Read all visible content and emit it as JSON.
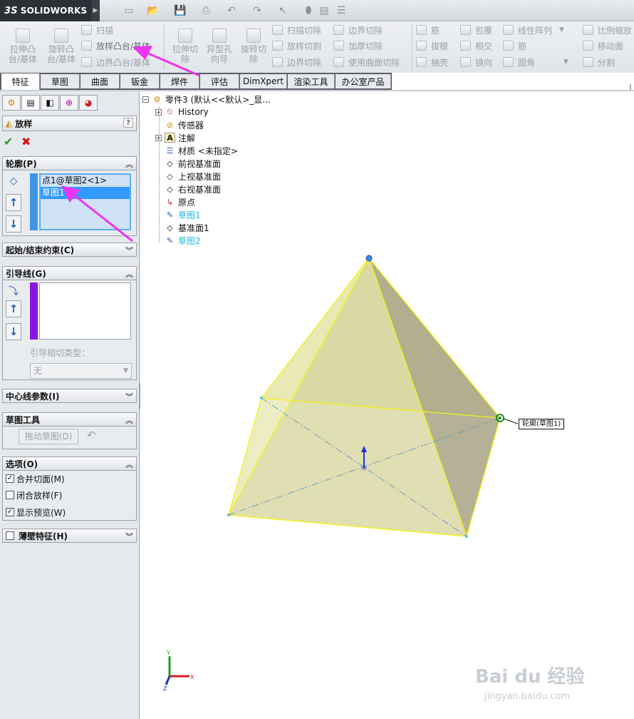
{
  "app": {
    "logo_brand": "SOLIDWORKS",
    "logo_prefix": "3S"
  },
  "ribbon": {
    "extrude_boss": "拉伸凸\n台/基体",
    "revolve_boss": "旋转凸\n台/基体",
    "sweep": "扫描",
    "loft_boss": "放样凸台/基体",
    "boundary_boss": "边界凸台/基体",
    "extrude_cut": "拉伸切\n除",
    "hole_wizard": "异型孔\n向导",
    "revolve_cut": "旋转切\n除",
    "swept_cut": "扫描切除",
    "lofted_cut": "放样切割",
    "boundary_cut": "边界切除",
    "boundary_cut2": "边界切除",
    "thicken_cut": "加厚切除",
    "surface_cut": "使用曲面切除",
    "rib": "筋",
    "draft": "拔模",
    "shell": "抽壳",
    "wrap": "包覆",
    "intersect": "相交",
    "mirror": "镜向",
    "linear_pattern": "线性阵列",
    "rib2": "筋",
    "fillet": "圆角",
    "scale": "比例缩放",
    "move_face": "移动面",
    "split": "分割"
  },
  "tabs": [
    "特征",
    "草图",
    "曲面",
    "钣金",
    "焊件",
    "评估",
    "DimXpert",
    "渲染工具",
    "办公室产品"
  ],
  "panel": {
    "title": "放样",
    "help": "?",
    "profile_group": "轮廓(P)",
    "profile_items": [
      "点1@草图2<1>",
      "草图1"
    ],
    "start_end": "起始/结束约束(C)",
    "guides_group": "引导线(G)",
    "guide_tangency_label": "引导相切类型：",
    "guide_tangency_value": "无",
    "centerline": "中心线参数(I)",
    "sketch_tools": "草图工具",
    "drag_sketch": "拖动草图(D)",
    "options": "选项(O)",
    "merge_tangent": "合并切面(M)",
    "close_loft": "闭合放样(F)",
    "show_preview": "显示预览(W)",
    "thin_feature": "薄壁特征(H)"
  },
  "tree": {
    "root": "零件3 (默认<<默认>_显...",
    "items": [
      "History",
      "传感器",
      "注解",
      "材质 <未指定>",
      "前视基准面",
      "上视基准面",
      "右视基准面",
      "原点",
      "草图1",
      "基准面1",
      "草图2"
    ]
  },
  "callout": "轮廓(草图1)",
  "triad": {
    "y": "Y",
    "x": "X",
    "z": "Z"
  },
  "watermark": {
    "main": "Bai du 经验",
    "url": "jingyan.baidu.com"
  }
}
